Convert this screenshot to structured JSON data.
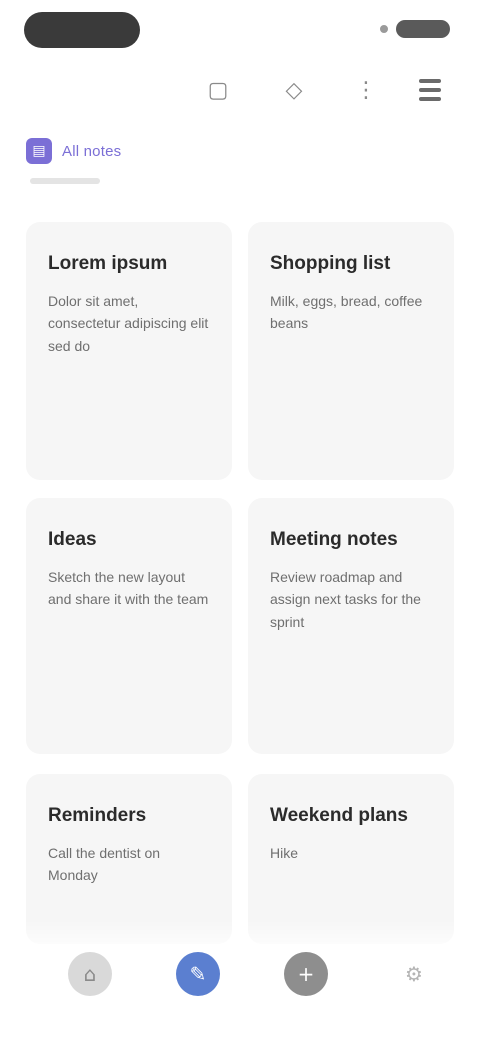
{
  "status_bar": {
    "pill_icon": "status-pill",
    "battery_icon": "battery-icon"
  },
  "app_bar": {
    "icons": [
      "view-toggle-icon",
      "label-icon",
      "more-icon",
      "menu-icon"
    ]
  },
  "filter": {
    "label": "All notes",
    "icon": "filter-icon"
  },
  "notes": [
    {
      "title": "Lorem ipsum",
      "body": "Dolor sit amet, consectetur adipiscing elit sed do"
    },
    {
      "title": "Shopping list",
      "body": "Milk, eggs, bread, coffee beans"
    },
    {
      "title": "Ideas",
      "body": "Sketch the new layout and share it with the team"
    },
    {
      "title": "Meeting notes",
      "body": "Review roadmap and assign next tasks for the sprint"
    },
    {
      "title": "Reminders",
      "body": "Call the dentist on Monday"
    },
    {
      "title": "Weekend plans",
      "body": "Hike"
    }
  ],
  "bottom_nav": {
    "items": [
      "home-icon",
      "notes-icon",
      "add-icon",
      "settings-icon"
    ]
  },
  "colors": {
    "accent": "#7b6fd6",
    "primary_nav": "#5b7fd0",
    "card_bg": "#f6f6f6"
  }
}
